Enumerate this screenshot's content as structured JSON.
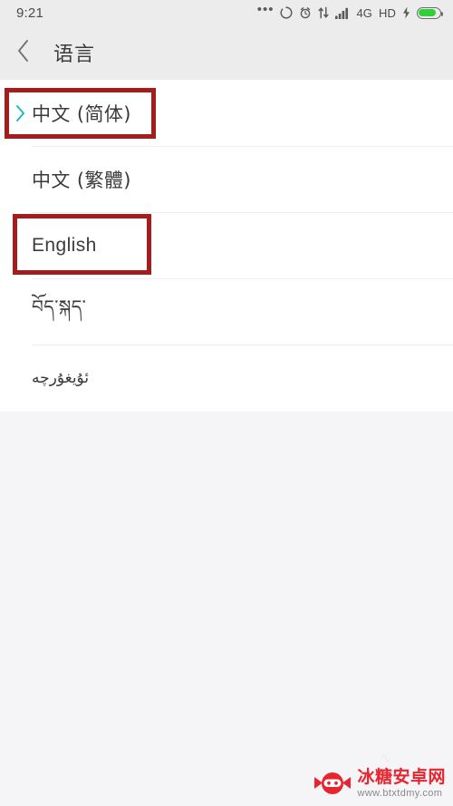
{
  "statusbar": {
    "clock": "9:21",
    "overflow_dots": "•••",
    "icons": [
      {
        "name": "sync-circle-icon"
      },
      {
        "name": "alarm-clock-icon"
      },
      {
        "name": "data-transfer-icon"
      },
      {
        "name": "signal-bars-icon"
      }
    ],
    "network_label": "4G",
    "hd_label": "HD",
    "charging_label": "⚡",
    "battery_level_pct": 82,
    "battery_color": "#31cf39",
    "background": "#ececec"
  },
  "header": {
    "back_icon": "chevron-left-icon",
    "title": "语言",
    "background": "#ececec"
  },
  "languages": {
    "items": [
      {
        "label": "中文 (简体)",
        "script": "han",
        "selected": true,
        "chevron": "chevron-right-icon",
        "chevron_color": "#22b8c0",
        "annotated": true
      },
      {
        "label": "中文 (繁體)",
        "script": "han",
        "selected": false,
        "annotated": false
      },
      {
        "label": "English",
        "script": "latin",
        "selected": false,
        "annotated": true
      },
      {
        "label": "བོད་སྐད་",
        "script": "tibetan",
        "selected": false,
        "annotated": false
      },
      {
        "label": "ئۇيغۇرچە",
        "script": "uyghur",
        "selected": false,
        "annotated": false
      }
    ]
  },
  "annotations": {
    "color": "#a51c1c",
    "boxes": [
      {
        "target": "中文 (简体)"
      },
      {
        "target": "English"
      }
    ]
  },
  "watermark": {
    "logo_icon": "candy-ninja-logo-icon",
    "title": "冰糖安卓网",
    "url": "www.btxtdmy.com",
    "title_color": "#e8252f"
  },
  "page_background": "#f5f4f7"
}
